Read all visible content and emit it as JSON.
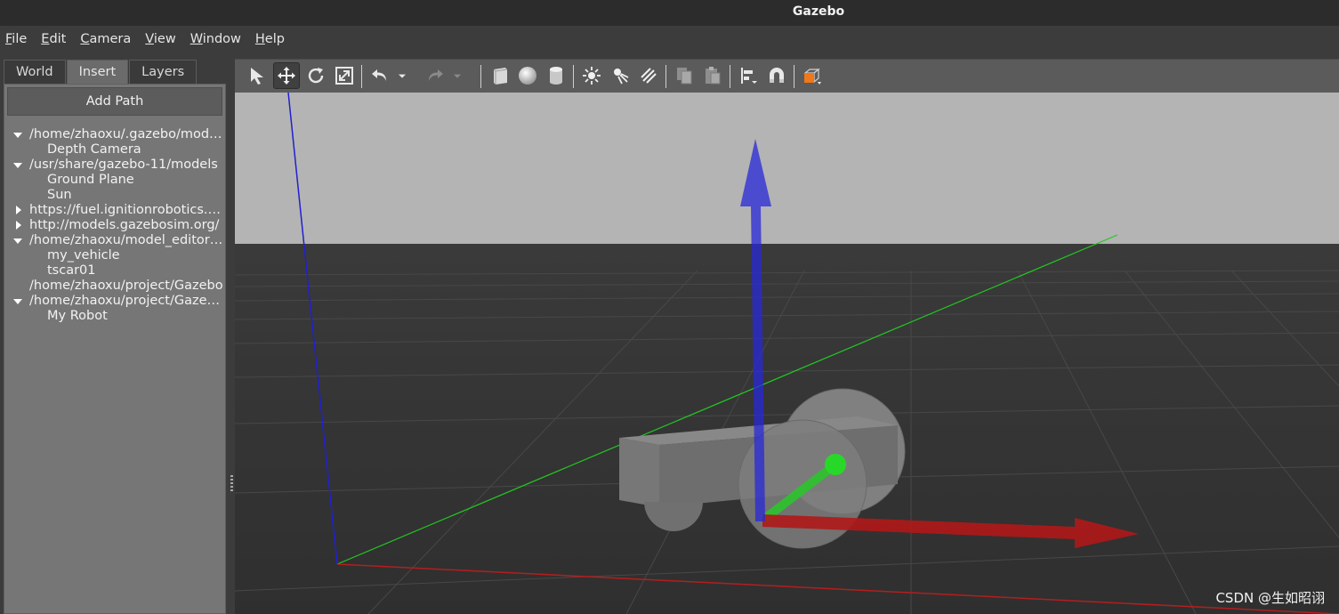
{
  "window": {
    "title": "Gazebo"
  },
  "menubar": {
    "items": [
      {
        "mnemonic": "F",
        "rest": "ile"
      },
      {
        "mnemonic": "E",
        "rest": "dit"
      },
      {
        "mnemonic": "C",
        "rest": "amera"
      },
      {
        "mnemonic": "V",
        "rest": "iew"
      },
      {
        "mnemonic": "W",
        "rest": "indow"
      },
      {
        "mnemonic": "H",
        "rest": "elp"
      }
    ]
  },
  "left_panel": {
    "tabs": [
      {
        "label": "World"
      },
      {
        "label": "Insert",
        "active": true
      },
      {
        "label": "Layers"
      }
    ],
    "add_path_label": "Add Path",
    "tree": [
      {
        "label": "/home/zhaoxu/.gazebo/models/",
        "expanded": true,
        "children": [
          {
            "label": "Depth Camera"
          }
        ]
      },
      {
        "label": "/usr/share/gazebo-11/models",
        "expanded": true,
        "children": [
          {
            "label": "Ground Plane"
          },
          {
            "label": "Sun"
          }
        ]
      },
      {
        "label": "https://fuel.ignitionrobotics.org",
        "expanded": false,
        "children": []
      },
      {
        "label": "http://models.gazebosim.org/",
        "expanded": false,
        "children": []
      },
      {
        "label": "/home/zhaoxu/model_editor_models",
        "expanded": true,
        "children": [
          {
            "label": "my_vehicle"
          },
          {
            "label": "tscar01"
          }
        ]
      },
      {
        "label": "/home/zhaoxu/project/Gazebo",
        "expanded": null,
        "children": []
      },
      {
        "label": "/home/zhaoxu/project/Gazebo/",
        "expanded": true,
        "children": [
          {
            "label": "My Robot"
          }
        ]
      }
    ]
  },
  "toolbar": {
    "icons": [
      "arrow-select-icon",
      "translate-icon",
      "rotate-icon",
      "scale-icon",
      "undo-icon",
      "undo-dropdown-icon",
      "redo-icon",
      "redo-dropdown-icon",
      "box-icon",
      "sphere-icon",
      "cylinder-icon",
      "point-light-icon",
      "spot-light-icon",
      "directional-light-icon",
      "copy-icon",
      "paste-icon",
      "align-icon",
      "snap-icon",
      "view-angle-icon"
    ],
    "active_tool": "translate-icon"
  },
  "viewport": {
    "colors": {
      "sky": "#b4b4b4",
      "ground": "#333333",
      "x_axis": "#b41e1e",
      "y_axis": "#1ec81e",
      "z_axis": "#1e1ec8"
    }
  },
  "watermark": "CSDN @生如昭诩"
}
